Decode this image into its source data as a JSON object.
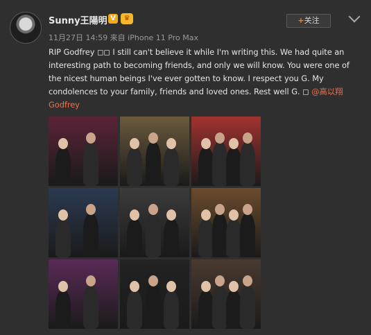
{
  "user": {
    "name": "Sunny王陽明",
    "verified_badge": "V",
    "fan_badge": "♛",
    "timestamp": "11月27日 14:59 来自 iPhone 11 Pro Max"
  },
  "actions": {
    "follow_label": "关注",
    "follow_plus": "+"
  },
  "post": {
    "text": "RIP Godfrey ◻◻ I still can't believe it while I'm writing this. We had quite an interesting path to becoming friends, and only we will know. You were one of the nicest human beings I've ever gotten to know. I respect you G. My condolences to your family, friends and loved ones. Rest well G. ◻ ",
    "mention_line1": "@高以翔",
    "mention_line2": "Godfrey"
  },
  "photos": [
    {
      "name": "photo-event-awards",
      "bg": "#5b2338"
    },
    {
      "name": "photo-kiss-stage",
      "bg": "#6b5a3c"
    },
    {
      "name": "photo-red-carpet",
      "bg": "#a2332f"
    },
    {
      "name": "photo-basketball-arena",
      "bg": "#2b3a52"
    },
    {
      "name": "photo-group-bw",
      "bg": "#3b3b3b"
    },
    {
      "name": "photo-group-bar",
      "bg": "#6a4b2c"
    },
    {
      "name": "photo-stage-group",
      "bg": "#5a2a57"
    },
    {
      "name": "photo-signs-group",
      "bg": "#222222"
    },
    {
      "name": "photo-selfie-bed",
      "bg": "#4a3a30"
    }
  ]
}
